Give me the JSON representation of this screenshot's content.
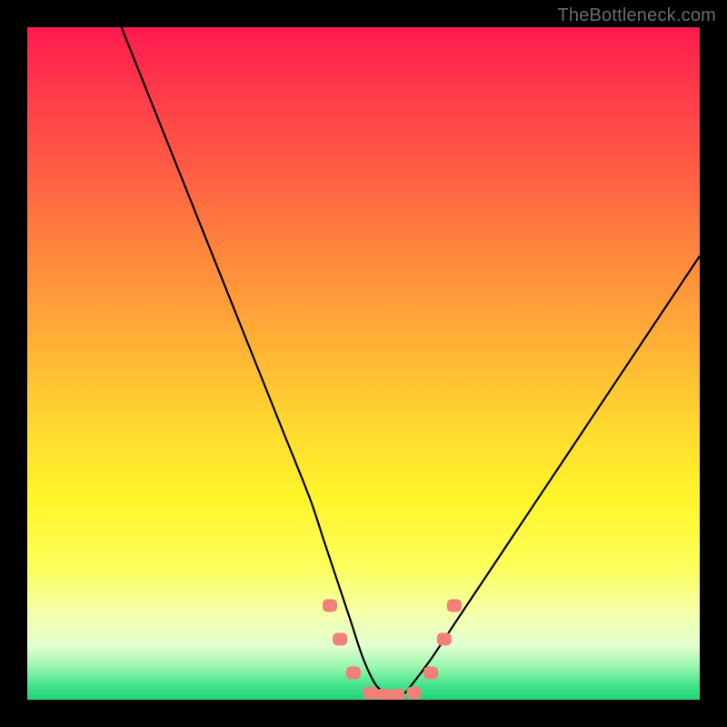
{
  "watermark": "TheBottleneck.com",
  "chart_data": {
    "type": "line",
    "title": "",
    "xlabel": "",
    "ylabel": "",
    "xlim": [
      0,
      100
    ],
    "ylim": [
      0,
      100
    ],
    "grid": false,
    "curve": {
      "x": [
        14,
        18,
        22,
        26,
        30,
        34,
        38,
        42,
        44,
        46,
        48,
        50,
        52,
        54,
        56,
        57,
        60,
        64,
        68,
        72,
        76,
        80,
        84,
        88,
        92,
        96,
        100
      ],
      "y": [
        100,
        90,
        80,
        70,
        60,
        50,
        40,
        30,
        24,
        18,
        12,
        6,
        2,
        1,
        1,
        2,
        6,
        12,
        18,
        24,
        30,
        36,
        42,
        48,
        54,
        60,
        66
      ]
    },
    "markers": [
      {
        "x": 45.0,
        "y": 14.0
      },
      {
        "x": 46.5,
        "y": 9.0
      },
      {
        "x": 48.5,
        "y": 4.0
      },
      {
        "x": 51.0,
        "y": 1.0
      },
      {
        "x": 53.0,
        "y": 0.7
      },
      {
        "x": 55.0,
        "y": 0.7
      },
      {
        "x": 57.5,
        "y": 1.0
      },
      {
        "x": 60.0,
        "y": 4.0
      },
      {
        "x": 62.0,
        "y": 9.0
      },
      {
        "x": 63.5,
        "y": 14.0
      }
    ],
    "marker_color": "#f08078",
    "curve_color": "#000000"
  }
}
